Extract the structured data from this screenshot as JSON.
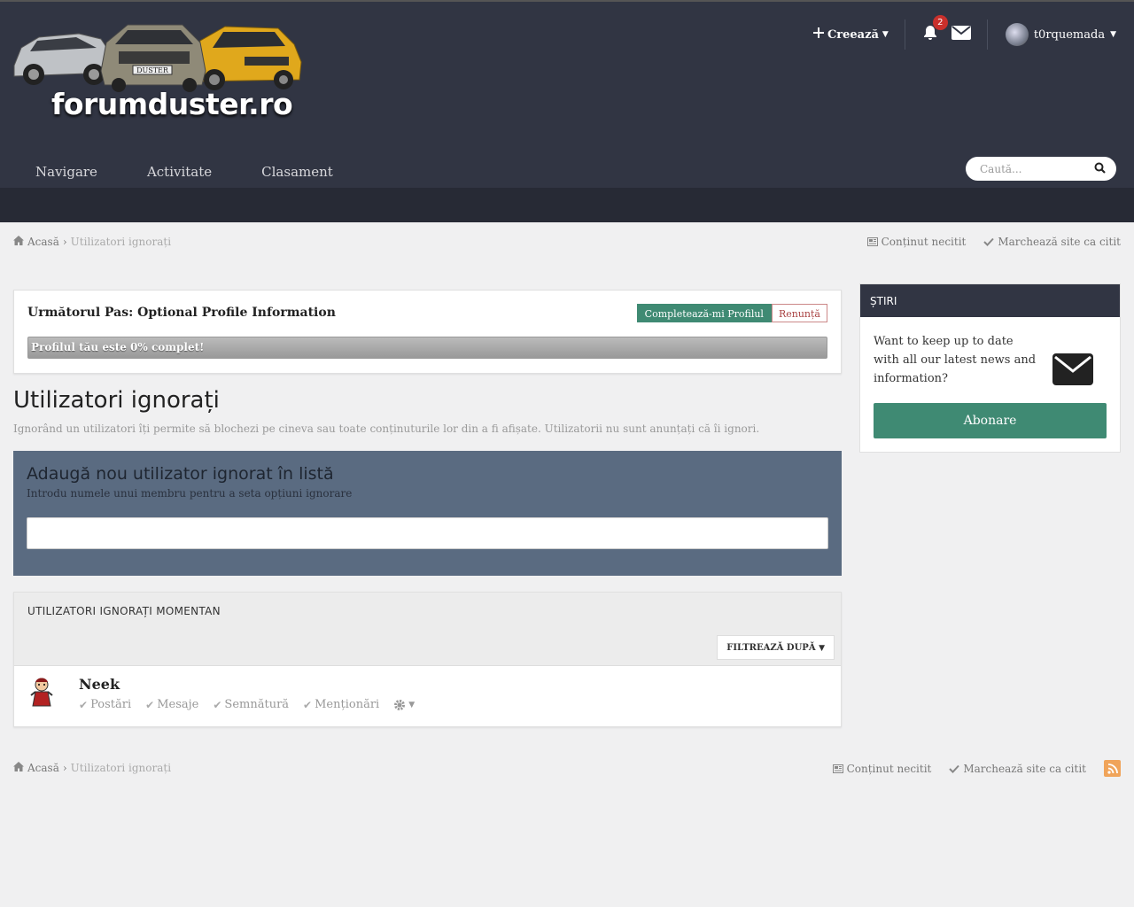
{
  "header": {
    "site_name": "forumduster.ro",
    "create_label": "Creează",
    "notification_count": "2",
    "username": "t0rquemada"
  },
  "nav": {
    "items": [
      {
        "label": "Navigare"
      },
      {
        "label": "Activitate"
      },
      {
        "label": "Clasament"
      }
    ]
  },
  "search": {
    "placeholder": "Caută..."
  },
  "breadcrumb": {
    "home": "Acasă",
    "current": "Utilizatori ignorați",
    "unread": "Conținut necitit",
    "mark_read": "Marchează site ca citit"
  },
  "profile_step": {
    "title": "Următorul Pas: Optional Profile Information",
    "complete_label": "Completează-mi Profilul",
    "cancel_label": "Renunță",
    "progress_text": "Profilul tău este 0% complet!",
    "progress_percent": 0
  },
  "page": {
    "title": "Utilizatori ignorați",
    "description": "Ignorând un utilizatori îți permite să blochezi pe cineva sau toate conținuturile lor din a fi afișate. Utilizatorii nu sunt anunțați că îi ignori."
  },
  "add_ignore": {
    "title": "Adaugă nou utilizator ignorat în listă",
    "subtitle": "Introdu numele unui membru pentru a seta opțiuni ignorare",
    "value": ""
  },
  "ignored": {
    "title": "UTILIZATORI IGNORAȚI MOMENTAN",
    "filter_label": "FILTREAZĂ DUPĂ",
    "members": [
      {
        "name": "Neek",
        "options": [
          "Postări",
          "Mesaje",
          "Semnătură",
          "Menționări"
        ]
      }
    ]
  },
  "sidebar": {
    "news_title": "ȘTIRI",
    "news_text": "Want to keep up to date with all our latest news and information?",
    "subscribe_label": "Abonare"
  },
  "colors": {
    "header_bg": "#313543",
    "accent_green": "#3f8a73",
    "add_box_bg": "#5a6b81"
  }
}
